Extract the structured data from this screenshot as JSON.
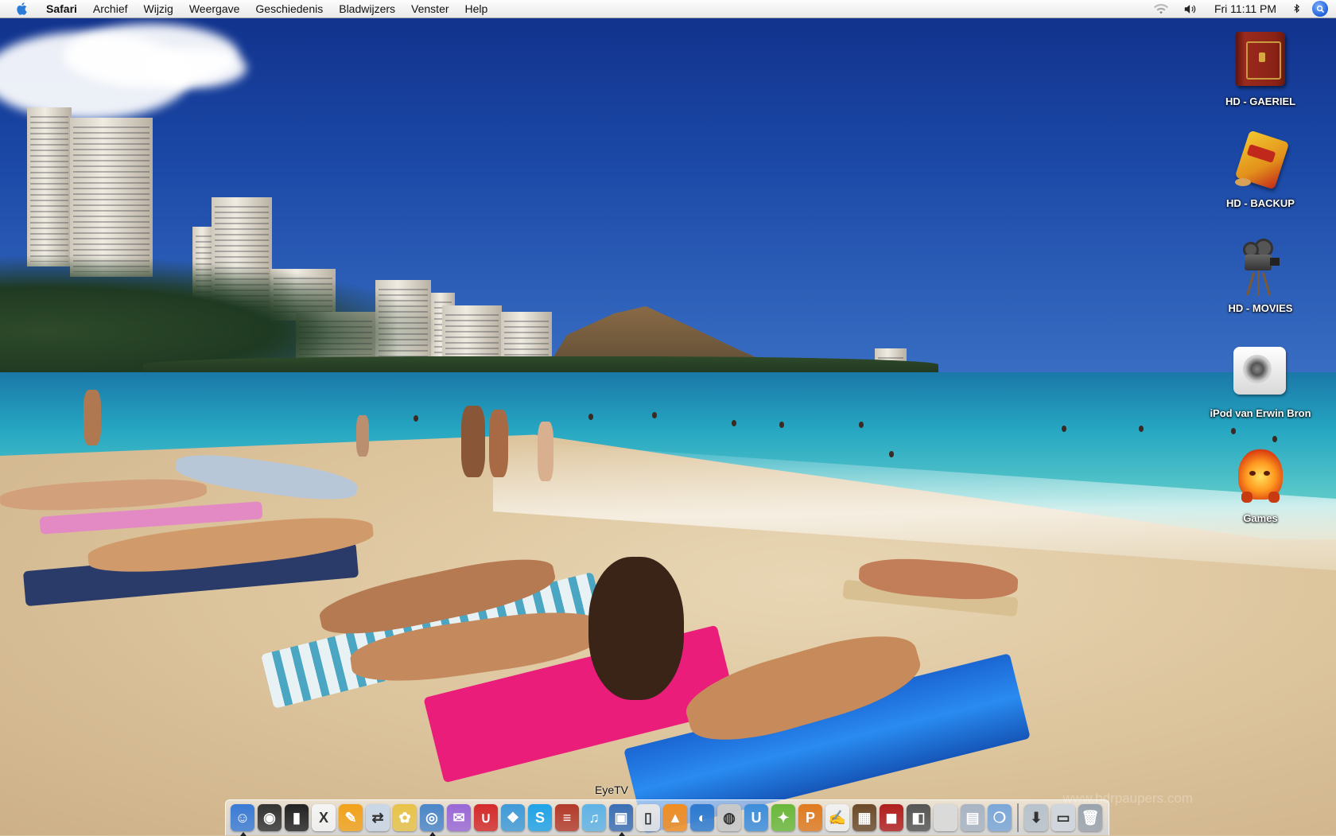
{
  "menubar": {
    "apple_icon": "apple-icon",
    "app_name": "Safari",
    "menus": [
      "Archief",
      "Wijzig",
      "Weergave",
      "Geschiedenis",
      "Bladwijzers",
      "Venster",
      "Help"
    ],
    "clock": "Fri 11:11 PM",
    "status_icons": [
      "wifi-icon",
      "volume-icon",
      "bluetooth-icon",
      "spotlight-icon"
    ]
  },
  "desktop": {
    "icons": [
      {
        "label": "HD - GAERIEL",
        "icon": "book-drive-icon"
      },
      {
        "label": "HD - BACKUP",
        "icon": "chips-bag-drive-icon"
      },
      {
        "label": "HD - MOVIES",
        "icon": "film-camera-drive-icon"
      },
      {
        "label": "iPod van Erwin Bron",
        "icon": "ipod-speaker-icon"
      },
      {
        "label": "Games",
        "icon": "fire-creature-icon"
      }
    ],
    "watermark": "www.hdrpaupers.com"
  },
  "dock": {
    "hover_label": "EyeTV",
    "apps": [
      {
        "name": "finder",
        "color": "#3a7bd5",
        "glyph": "☺",
        "running": true
      },
      {
        "name": "dashboard",
        "color": "#333333",
        "glyph": "◉",
        "running": false
      },
      {
        "name": "terminal",
        "color": "#222222",
        "glyph": "▮",
        "running": false
      },
      {
        "name": "x11",
        "color": "#f4f4f4",
        "glyph": "X",
        "running": false
      },
      {
        "name": "pages",
        "color": "#f2a21b",
        "glyph": "✎",
        "running": false
      },
      {
        "name": "transmit",
        "color": "#c9d7e6",
        "glyph": "⇄",
        "running": false
      },
      {
        "name": "popcorn",
        "color": "#e8c34a",
        "glyph": "✿",
        "running": false
      },
      {
        "name": "safari",
        "color": "#4a86c9",
        "glyph": "◎",
        "running": true
      },
      {
        "name": "adium",
        "color": "#9a68d6",
        "glyph": "✉",
        "running": false
      },
      {
        "name": "magnet",
        "color": "#d42a2a",
        "glyph": "∪",
        "running": false
      },
      {
        "name": "ichat",
        "color": "#3f9ad8",
        "glyph": "❖",
        "running": false
      },
      {
        "name": "skype",
        "color": "#1fa3e8",
        "glyph": "S",
        "running": false
      },
      {
        "name": "notebook",
        "color": "#b33a2a",
        "glyph": "≡",
        "running": false
      },
      {
        "name": "itunes",
        "color": "#5fb3e6",
        "glyph": "♫",
        "running": false
      },
      {
        "name": "eyetv",
        "color": "#3b6fb4",
        "glyph": "▣",
        "running": true
      },
      {
        "name": "ipod",
        "color": "#e6e6e6",
        "glyph": "▯",
        "running": false
      },
      {
        "name": "vlc",
        "color": "#f18d21",
        "glyph": "▲",
        "running": false
      },
      {
        "name": "network",
        "color": "#2d7ad0",
        "glyph": "◐",
        "running": false
      },
      {
        "name": "disk-utility",
        "color": "#c8c8c8",
        "glyph": "◍",
        "running": false
      },
      {
        "name": "utility",
        "color": "#3c8ddb",
        "glyph": "U",
        "running": false
      },
      {
        "name": "tools",
        "color": "#6ab83a",
        "glyph": "✦",
        "running": false
      },
      {
        "name": "pencil",
        "color": "#e07a1f",
        "glyph": "P",
        "running": false
      },
      {
        "name": "textedit",
        "color": "#f0f0f0",
        "glyph": "✍",
        "running": false
      },
      {
        "name": "photo",
        "color": "#6b4a2a",
        "glyph": "▦",
        "running": false
      },
      {
        "name": "photo-booth",
        "color": "#b01e1e",
        "glyph": "◼",
        "running": false
      },
      {
        "name": "grapher",
        "color": "#555555",
        "glyph": "◧",
        "running": false
      },
      {
        "name": "system",
        "color": "#dadada",
        "glyph": "",
        "running": false
      },
      {
        "name": "printer",
        "color": "#a8b4c4",
        "glyph": "▤",
        "running": false
      },
      {
        "name": "clips",
        "color": "#7aa7d8",
        "glyph": "❍",
        "running": false
      }
    ],
    "extras": [
      {
        "name": "downloads",
        "color": "#b8c2cc",
        "glyph": "⬇"
      },
      {
        "name": "documents",
        "color": "#cfd6dd",
        "glyph": "▭"
      },
      {
        "name": "trash",
        "color": "#9aa3ad",
        "glyph": "🗑"
      }
    ]
  }
}
